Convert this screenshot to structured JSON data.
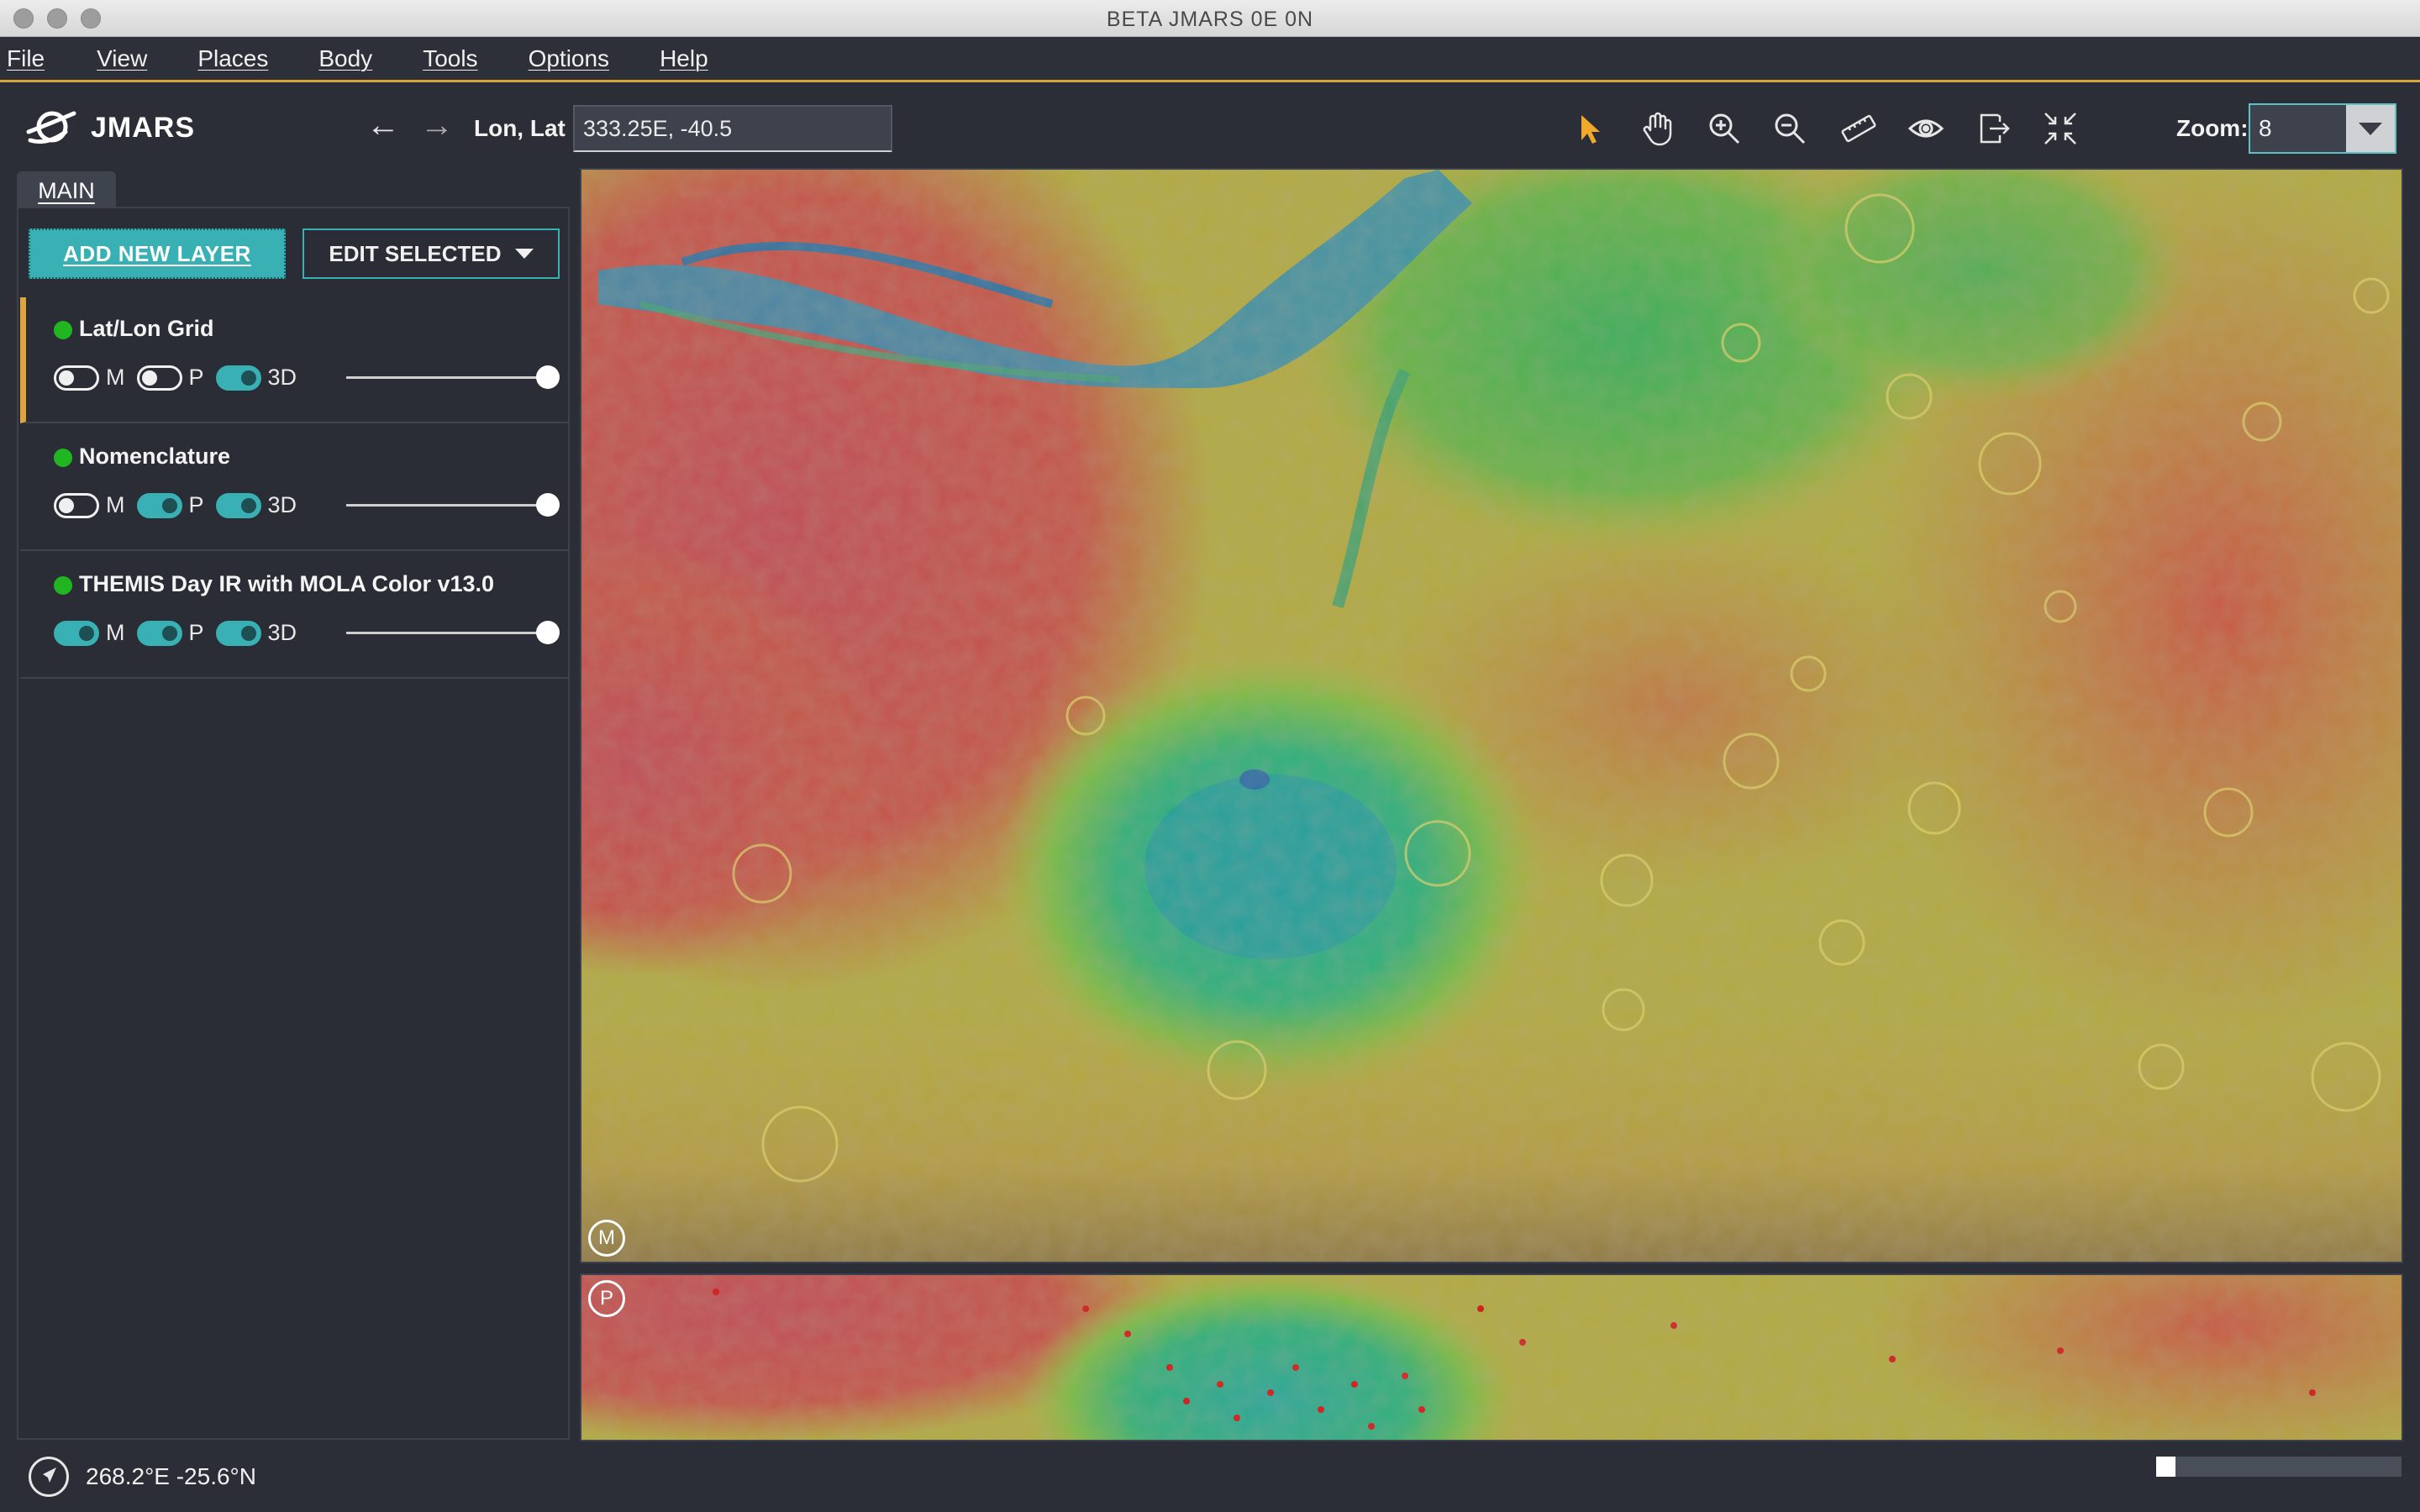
{
  "window": {
    "title": "BETA JMARS 0E 0N"
  },
  "menu": [
    "File",
    "View",
    "Places",
    "Body",
    "Tools",
    "Options",
    "Help"
  ],
  "toolbar": {
    "app_name": "JMARS",
    "coord_label": "Lon, Lat",
    "coord_value": "333.25E, -40.5",
    "zoom_label": "Zoom:",
    "zoom_value": "8",
    "tools": [
      "pointer-icon",
      "hand-pan-icon",
      "zoom-in-icon",
      "zoom-out-icon",
      "ruler-icon",
      "eye-icon",
      "export-icon",
      "resize-icon"
    ]
  },
  "panel": {
    "tab": "MAIN",
    "add_button": "ADD NEW LAYER",
    "edit_button": "EDIT SELECTED",
    "toggle_labels": {
      "m": "M",
      "p": "P",
      "d3": "3D"
    },
    "layers": [
      {
        "name": "Lat/Lon Grid",
        "m": false,
        "p": false,
        "d3": true,
        "opacity": 1.0,
        "selected": true
      },
      {
        "name": "Nomenclature",
        "m": false,
        "p": true,
        "d3": true,
        "opacity": 1.0,
        "selected": false
      },
      {
        "name": "THEMIS Day IR with MOLA Color v13.0",
        "m": true,
        "p": true,
        "d3": true,
        "opacity": 1.0,
        "selected": false
      }
    ]
  },
  "map": {
    "main_badge": "M",
    "panner_badge": "P"
  },
  "status": {
    "cursor_coord": "268.2°E -25.6°N",
    "progress": 0.08
  },
  "colors": {
    "accent": "#38b0b4",
    "highlight": "#e0a43f",
    "status_dot": "#21b521"
  }
}
